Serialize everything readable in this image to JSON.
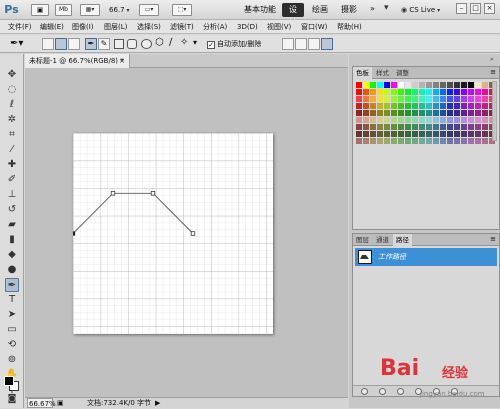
{
  "app": {
    "logo": "Ps",
    "mini_bridge": "Mb",
    "zoom": "66.7",
    "workspaces": [
      "基本功能",
      "设计",
      "绘画",
      "摄影"
    ],
    "cs_live": "CS Live"
  },
  "menu": [
    "文件(F)",
    "编辑(E)",
    "图像(I)",
    "图层(L)",
    "选择(S)",
    "滤镜(T)",
    "分析(A)",
    "3D(D)",
    "视图(V)",
    "窗口(W)",
    "帮助(H)"
  ],
  "options": {
    "auto_add_delete": "自动添加/删除"
  },
  "document": {
    "tab_title": "未标题-1 @ 66.7%(RGB/8) *",
    "zoom_status": "66.67%",
    "doc_info": "文档:732.4K/0 字节"
  },
  "panels": {
    "swatches_tabs": [
      "色板",
      "样式",
      "调整"
    ],
    "paths_tabs": [
      "图层",
      "通道",
      "路径"
    ],
    "work_path_label": "工作路径"
  },
  "watermark": {
    "logo": "Bai",
    "text": "经验",
    "url": "jingyan.baidu.com"
  },
  "path_shape": {
    "anchors": [
      [
        0,
        0.5
      ],
      [
        0.2,
        0.3
      ],
      [
        0.4,
        0.3
      ],
      [
        0.6,
        0.5
      ]
    ]
  },
  "colors": {
    "selection": "#3d8fd6",
    "accent": "#2d2d2d"
  }
}
